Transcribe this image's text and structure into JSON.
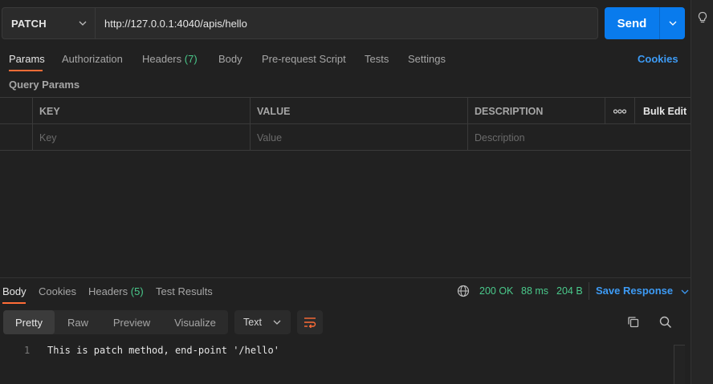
{
  "request": {
    "method": "PATCH",
    "url": "http://127.0.0.1:4040/apis/hello",
    "send_label": "Send"
  },
  "request_tabs": {
    "params": "Params",
    "authorization": "Authorization",
    "headers": "Headers",
    "headers_count": "(7)",
    "body": "Body",
    "pre_request": "Pre-request Script",
    "tests": "Tests",
    "settings": "Settings",
    "cookies": "Cookies"
  },
  "query_params": {
    "title": "Query Params",
    "columns": {
      "key": "KEY",
      "value": "VALUE",
      "description": "DESCRIPTION",
      "more": "ooo",
      "bulk_edit": "Bulk Edit"
    },
    "placeholders": {
      "key": "Key",
      "value": "Value",
      "description": "Description"
    }
  },
  "response": {
    "tabs": {
      "body": "Body",
      "cookies": "Cookies",
      "headers": "Headers",
      "headers_count": "(5)",
      "test_results": "Test Results"
    },
    "status": "200 OK",
    "time": "88 ms",
    "size": "204 B",
    "save_response": "Save Response",
    "views": {
      "pretty": "Pretty",
      "raw": "Raw",
      "preview": "Preview",
      "visualize": "Visualize"
    },
    "format": "Text",
    "lines": [
      {
        "number": "1",
        "text": "This is patch method, end-point '/hello'"
      }
    ]
  },
  "colors": {
    "accent_orange": "#ff6c37",
    "send_blue": "#097bed",
    "link_blue": "#3d9bf5",
    "success_green": "#4ac98b"
  }
}
